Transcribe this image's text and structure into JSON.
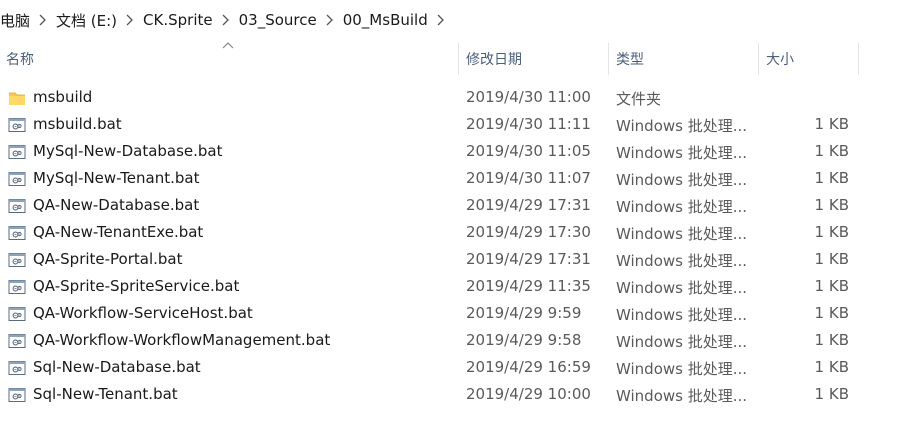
{
  "breadcrumb": [
    "电脑",
    "文档 (E:)",
    "CK.Sprite",
    "03_Source",
    "00_MsBuild"
  ],
  "columns": {
    "name": "名称",
    "date": "修改日期",
    "type": "类型",
    "size": "大小"
  },
  "files": [
    {
      "name": "msbuild",
      "date": "2019/4/30 11:00",
      "type": "文件夹",
      "size": "",
      "icon": "folder-icon"
    },
    {
      "name": "msbuild.bat",
      "date": "2019/4/30 11:11",
      "type": "Windows 批处理...",
      "size": "1 KB",
      "icon": "batch-file-icon"
    },
    {
      "name": "MySql-New-Database.bat",
      "date": "2019/4/30 11:05",
      "type": "Windows 批处理...",
      "size": "1 KB",
      "icon": "batch-file-icon"
    },
    {
      "name": "MySql-New-Tenant.bat",
      "date": "2019/4/30 11:07",
      "type": "Windows 批处理...",
      "size": "1 KB",
      "icon": "batch-file-icon"
    },
    {
      "name": "QA-New-Database.bat",
      "date": "2019/4/29 17:31",
      "type": "Windows 批处理...",
      "size": "1 KB",
      "icon": "batch-file-icon"
    },
    {
      "name": "QA-New-TenantExe.bat",
      "date": "2019/4/29 17:30",
      "type": "Windows 批处理...",
      "size": "1 KB",
      "icon": "batch-file-icon"
    },
    {
      "name": "QA-Sprite-Portal.bat",
      "date": "2019/4/29 17:31",
      "type": "Windows 批处理...",
      "size": "1 KB",
      "icon": "batch-file-icon"
    },
    {
      "name": "QA-Sprite-SpriteService.bat",
      "date": "2019/4/29 11:35",
      "type": "Windows 批处理...",
      "size": "1 KB",
      "icon": "batch-file-icon"
    },
    {
      "name": "QA-Workflow-ServiceHost.bat",
      "date": "2019/4/29 9:59",
      "type": "Windows 批处理...",
      "size": "1 KB",
      "icon": "batch-file-icon"
    },
    {
      "name": "QA-Workflow-WorkflowManagement.bat",
      "date": "2019/4/29 9:58",
      "type": "Windows 批处理...",
      "size": "1 KB",
      "icon": "batch-file-icon"
    },
    {
      "name": "Sql-New-Database.bat",
      "date": "2019/4/29 16:59",
      "type": "Windows 批处理...",
      "size": "1 KB",
      "icon": "batch-file-icon"
    },
    {
      "name": "Sql-New-Tenant.bat",
      "date": "2019/4/29 10:00",
      "type": "Windows 批处理...",
      "size": "1 KB",
      "icon": "batch-file-icon"
    }
  ]
}
